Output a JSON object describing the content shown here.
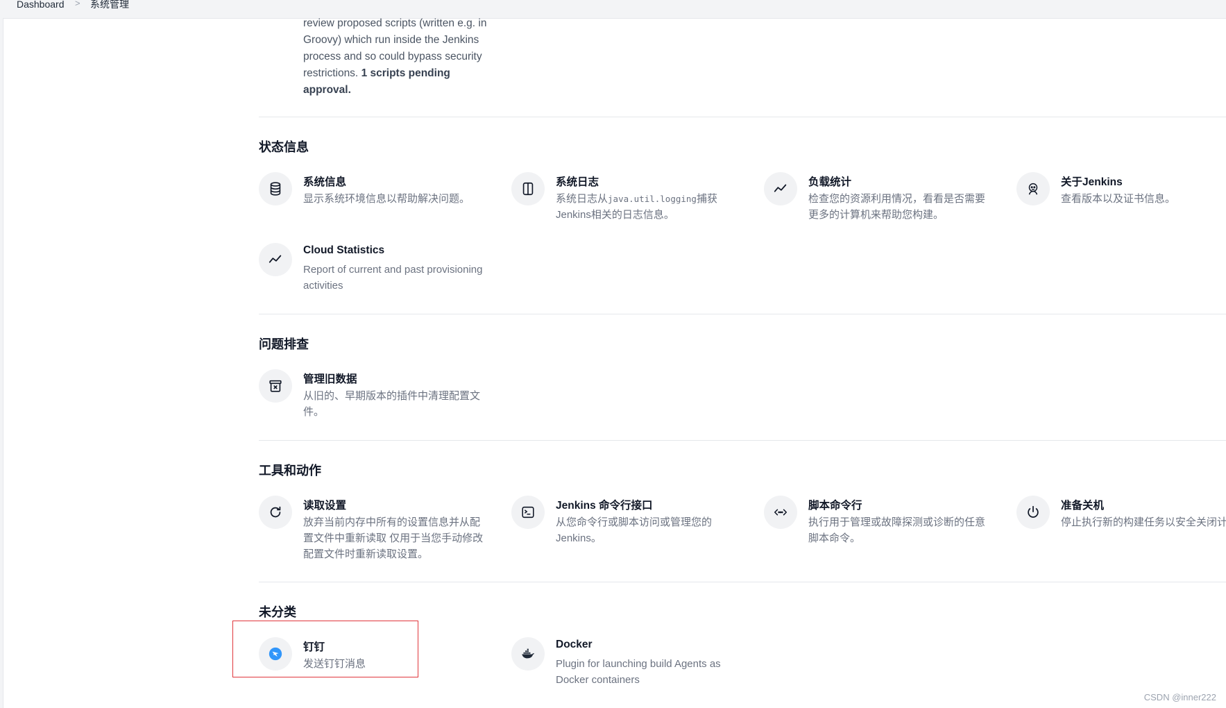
{
  "breadcrumb": {
    "home": "Dashboard",
    "current": "系统管理"
  },
  "intro": {
    "text": "review proposed scripts (written e.g. in Groovy) which run inside the Jenkins process and so could bypass security restrictions. ",
    "bold": "1 scripts pending approval."
  },
  "sections": {
    "status": {
      "title": "状态信息",
      "system_info": {
        "title": "系统信息",
        "desc": "显示系统环境信息以帮助解决问题。"
      },
      "system_log": {
        "title": "系统日志",
        "desc_a": "系统日志从",
        "desc_code": "java.util.logging",
        "desc_b": "捕获Jenkins相关的日志信息。"
      },
      "load_stats": {
        "title": "负载统计",
        "desc": "检查您的资源利用情况，看看是否需要更多的计算机来帮助您构建。"
      },
      "about": {
        "title": "关于Jenkins",
        "desc": "查看版本以及证书信息。"
      },
      "cloud_stats": {
        "title": "Cloud Statistics",
        "desc": "Report of current and past provisioning activities"
      }
    },
    "troubleshoot": {
      "title": "问题排查",
      "old_data": {
        "title": "管理旧数据",
        "desc": "从旧的、早期版本的插件中清理配置文件。"
      }
    },
    "tools": {
      "title": "工具和动作",
      "reload": {
        "title": "读取设置",
        "desc": "放弃当前内存中所有的设置信息并从配置文件中重新读取 仅用于当您手动修改配置文件时重新读取设置。"
      },
      "cli": {
        "title": "Jenkins 命令行接口",
        "desc": "从您命令行或脚本访问或管理您的Jenkins。"
      },
      "script_console": {
        "title": "脚本命令行",
        "desc": "执行用于管理或故障探测或诊断的任意脚本命令。"
      },
      "shutdown": {
        "title": "准备关机",
        "desc": "停止执行新的构建任务以安全关闭计算机。"
      }
    },
    "uncategorized": {
      "title": "未分类",
      "dingtalk": {
        "title": "钉钉",
        "desc": "发送钉钉消息"
      },
      "docker": {
        "title": "Docker",
        "desc": "Plugin for launching build Agents as Docker containers"
      }
    }
  },
  "colors": {
    "highlight": "#e0363b",
    "dingtalk": "#3296fa"
  },
  "watermark": "CSDN @inner222"
}
